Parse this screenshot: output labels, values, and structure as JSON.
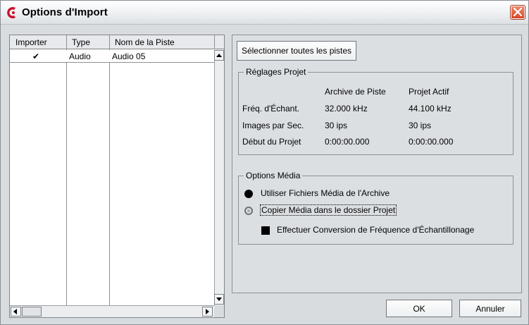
{
  "window": {
    "title": "Options d'Import",
    "close_icon": "close-icon",
    "app_icon": "cubase-logo-icon"
  },
  "track_list": {
    "columns": [
      "Importer",
      "Type",
      "Nom de la Piste"
    ],
    "rows": [
      {
        "import_checked": true,
        "check_glyph": "✔",
        "type": "Audio",
        "name": "Audio 05"
      }
    ],
    "scroll_up_icon": "chevron-up-icon",
    "scroll_down_icon": "chevron-down-icon",
    "scroll_left_icon": "chevron-left-icon",
    "scroll_right_icon": "chevron-right-icon"
  },
  "select_all_label": "Sélectionner toutes les pistes",
  "project_settings": {
    "legend": "Réglages Projet",
    "col_archive": "Archive de Piste",
    "col_active": "Projet Actif",
    "rows": [
      {
        "label": "Fréq. d'Échant.",
        "archive": "32.000 kHz",
        "active": "44.100 kHz"
      },
      {
        "label": "Images par Sec.",
        "archive": "30 ips",
        "active": "30 ips"
      },
      {
        "label": "Début du Projet",
        "archive": "0:00:00.000",
        "active": "0:00:00.000"
      }
    ]
  },
  "media_options": {
    "legend": "Options Média",
    "option_use_archive": "Utiliser Fichiers Média de l'Archive",
    "option_copy_media": "Copier Média dans le dossier Projet",
    "selected": "option_use_archive",
    "checkbox_convert": "Effectuer Conversion de Fréquence d'Échantillonage",
    "convert_checked": true
  },
  "buttons": {
    "ok": "OK",
    "cancel": "Annuler"
  }
}
